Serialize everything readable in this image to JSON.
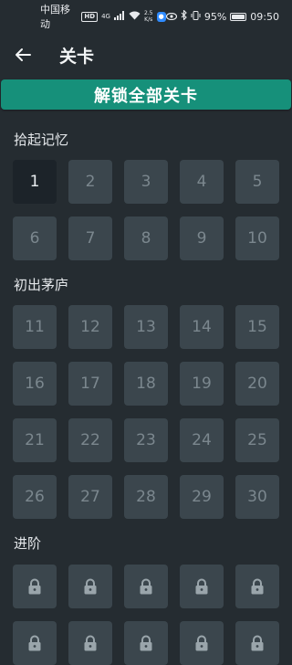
{
  "status_bar": {
    "carrier": "中国移动",
    "hd": "HD",
    "network": "4G",
    "speed_value": "2.5",
    "speed_unit": "K/s",
    "battery": "95%",
    "time": "09:50"
  },
  "header": {
    "title": "关卡"
  },
  "unlock_all_label": "解锁全部关卡",
  "sections": [
    {
      "title": "拾起记忆",
      "levels": [
        "1",
        "2",
        "3",
        "4",
        "5",
        "6",
        "7",
        "8",
        "9",
        "10"
      ],
      "active": "1"
    },
    {
      "title": "初出茅庐",
      "levels": [
        "11",
        "12",
        "13",
        "14",
        "15",
        "16",
        "17",
        "18",
        "19",
        "20",
        "21",
        "22",
        "23",
        "24",
        "25",
        "26",
        "27",
        "28",
        "29",
        "30"
      ]
    },
    {
      "title": "进阶",
      "locked_count": 10
    }
  ],
  "colors": {
    "background": "#252c31",
    "accent": "#16907a",
    "tile": "#3b464d",
    "tile_active": "#1c2329"
  }
}
